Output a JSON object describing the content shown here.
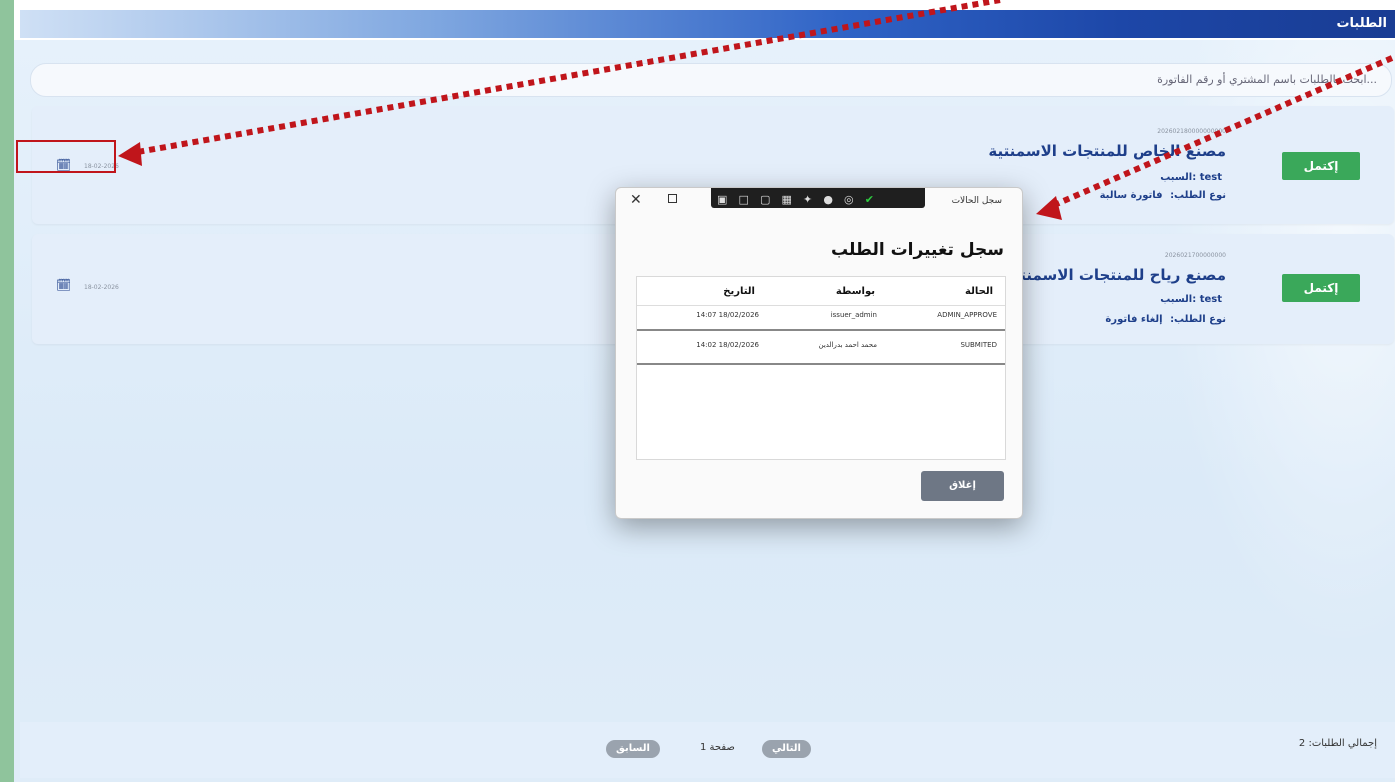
{
  "header": {
    "title": "الطلبات"
  },
  "search": {
    "placeholder": "ابحث بالطلبات باسم المشتري أو رقم الفاتورة..."
  },
  "requests": [
    {
      "number": "202602180000000000",
      "customer": "مصنع الخاص للمنتجات الاسمنتية",
      "reason_label": "السبب:",
      "reason_value": "test",
      "type_label": "نوع الطلب:",
      "type_value": "فاتورة سالبة",
      "date": "18-02-2026",
      "accept_label": "إكتمل"
    },
    {
      "number": "2026021700000000",
      "customer": "مصنع رياح للمنتجات الاسمنتية",
      "reason_label": "السبب:",
      "reason_value": "test",
      "type_label": "نوع الطلب:",
      "type_value": "إلغاء فاتورة",
      "date": "18-02-2026",
      "accept_label": "إكتمل"
    }
  ],
  "footer": {
    "total_label": "إجمالي الطلبات: 2",
    "next_label": "التالي",
    "page_label": "صفحة 1",
    "prev_label": "السابق"
  },
  "modal": {
    "window_title": "سجل الحالات",
    "heading": "سجل تغييرات الطلب",
    "columns": [
      "الحالة",
      "بواسطة",
      "التاريخ"
    ],
    "rows": [
      {
        "status": "ADMIN_APPROVE",
        "by": "issuer_admin",
        "date": "14:07 18/02/2026"
      },
      {
        "status": "SUBMITED",
        "by": "محمد احمد بدرالدين",
        "date": "14:02 18/02/2026"
      }
    ],
    "close_label": "إغلاق"
  },
  "colors": {
    "accent": "#3aa85a",
    "title_blue": "#1e3f8a",
    "annotation_red": "#c0151b"
  }
}
